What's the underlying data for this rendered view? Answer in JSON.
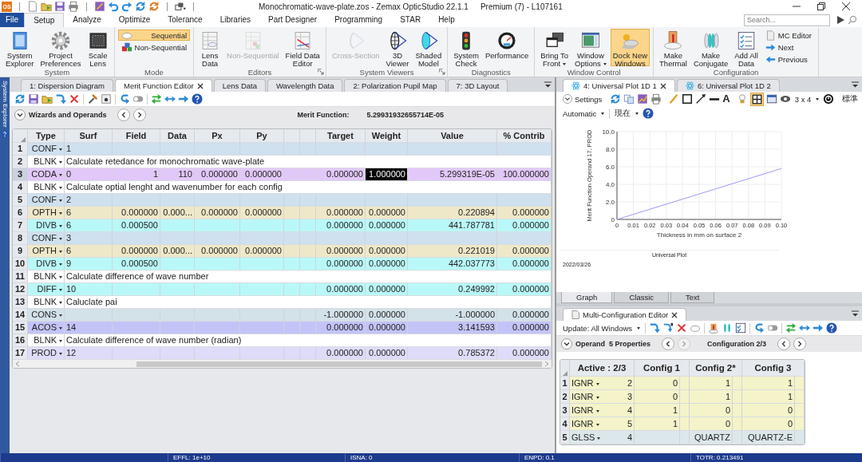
{
  "title_bar": {
    "app_logo": "OS",
    "title": "Monochromatic-wave-plate.zos - Zemax OpticStudio 22.1.1",
    "license": "Premium (7) - L107161"
  },
  "menu_tabs": [
    {
      "label": "File",
      "kind": "file",
      "selected": false
    },
    {
      "label": "Setup",
      "kind": "tab",
      "selected": true
    },
    {
      "label": "Analyze",
      "kind": "tab",
      "selected": false
    },
    {
      "label": "Optimize",
      "kind": "tab",
      "selected": false
    },
    {
      "label": "Tolerance",
      "kind": "tab",
      "selected": false
    },
    {
      "label": "Libraries",
      "kind": "tab",
      "selected": false
    },
    {
      "label": "Part Designer",
      "kind": "tab",
      "selected": false
    },
    {
      "label": "Programming",
      "kind": "tab",
      "selected": false
    },
    {
      "label": "STAR",
      "kind": "tab",
      "selected": false
    },
    {
      "label": "Help",
      "kind": "tab",
      "selected": false
    }
  ],
  "search": {
    "placeholder": "Search..."
  },
  "ribbon": [
    {
      "group": "System",
      "launcher": false,
      "buttons": [
        {
          "label": "System\nExplorer",
          "kind": "large",
          "disabled": false,
          "active": false,
          "dropdown": false
        },
        {
          "label": "Project\nPreferences",
          "kind": "large",
          "disabled": false,
          "active": false,
          "dropdown": false
        },
        {
          "label": "Scale\nLens",
          "kind": "large",
          "disabled": false,
          "active": false,
          "dropdown": false
        }
      ]
    },
    {
      "group": "Mode",
      "launcher": false,
      "buttons": [
        {
          "label": "Sequential",
          "kind": "small",
          "disabled": false,
          "active": true,
          "dropdown": false
        },
        {
          "label": "Non-Sequential",
          "kind": "small",
          "disabled": false,
          "active": false,
          "dropdown": false
        }
      ]
    },
    {
      "group": "Editors",
      "launcher": true,
      "buttons": [
        {
          "label": "Lens\nData",
          "kind": "large",
          "disabled": false,
          "active": false,
          "dropdown": false
        },
        {
          "label": "Non-Sequential",
          "kind": "large",
          "disabled": true,
          "active": false,
          "dropdown": false
        },
        {
          "label": "Field Data\nEditor",
          "kind": "large",
          "disabled": false,
          "active": false,
          "dropdown": false
        }
      ]
    },
    {
      "group": "System Viewers",
      "launcher": true,
      "buttons": [
        {
          "label": "Cross-Section",
          "kind": "large",
          "disabled": true,
          "active": false,
          "dropdown": false
        },
        {
          "label": "3D\nViewer",
          "kind": "large",
          "disabled": false,
          "active": false,
          "dropdown": false
        },
        {
          "label": "Shaded\nModel",
          "kind": "large",
          "disabled": false,
          "active": false,
          "dropdown": false
        }
      ]
    },
    {
      "group": "Diagnostics",
      "launcher": false,
      "buttons": [
        {
          "label": "System\nCheck",
          "kind": "large",
          "disabled": false,
          "active": false,
          "dropdown": false
        },
        {
          "label": "Performance",
          "kind": "large",
          "disabled": false,
          "active": false,
          "dropdown": false
        }
      ]
    },
    {
      "group": "Window Control",
      "launcher": false,
      "buttons": [
        {
          "label": "Bring To\nFront",
          "kind": "large",
          "disabled": false,
          "active": false,
          "dropdown": true
        },
        {
          "label": "Window\nOptions",
          "kind": "large",
          "disabled": false,
          "active": false,
          "dropdown": true
        },
        {
          "label": "Dock New\nWindows",
          "kind": "large",
          "disabled": false,
          "active": true,
          "dropdown": false
        }
      ]
    },
    {
      "group": "Configuration",
      "launcher": false,
      "buttons": [
        {
          "label": "Make\nThermal",
          "kind": "large",
          "disabled": false,
          "active": false,
          "dropdown": false
        },
        {
          "label": "Make\nConjugate",
          "kind": "large",
          "disabled": false,
          "active": false,
          "dropdown": false
        },
        {
          "label": "Add All\nData",
          "kind": "large",
          "disabled": false,
          "active": false,
          "dropdown": false
        },
        {
          "label": "MC Editor",
          "kind": "small",
          "disabled": false,
          "active": false,
          "dropdown": false
        },
        {
          "label": "Next",
          "kind": "small",
          "disabled": false,
          "active": false,
          "dropdown": false
        },
        {
          "label": "Previous",
          "kind": "small",
          "disabled": false,
          "active": false,
          "dropdown": false
        }
      ]
    }
  ],
  "side_strip": {
    "label": "System Explorer"
  },
  "left_pane": {
    "tabs": [
      {
        "label": "1: Dispersion Diagram",
        "selected": false,
        "closable": false
      },
      {
        "label": "Merit Function Editor",
        "selected": true,
        "closable": true
      },
      {
        "label": "Lens Data",
        "selected": false,
        "closable": false
      },
      {
        "label": "Wavelength Data",
        "selected": false,
        "closable": false
      },
      {
        "label": "2: Polarization Pupil Map",
        "selected": false,
        "closable": false
      },
      {
        "label": "7: 3D Layout",
        "selected": false,
        "closable": false
      }
    ],
    "wizard": {
      "label": "Wizards and Operands",
      "metric_label": "Merit Function:",
      "metric_value": "5.29931932655714E-05"
    },
    "table": {
      "columns": [
        "Type",
        "Surf",
        "Field",
        "Data",
        "Px",
        "Py",
        "Target",
        "Weight",
        "Value",
        "% Contrib"
      ],
      "rows": [
        {
          "num": "1",
          "kind": "operand",
          "type": "CONF",
          "surf": "1",
          "color": "#cfe0ef",
          "selected": false
        },
        {
          "num": "2",
          "kind": "comment",
          "type": "BLNK",
          "comment": "Calculate retedance for monochromatic wave-plate",
          "color": "#ffffff",
          "selected": false
        },
        {
          "num": "3",
          "kind": "operand",
          "type": "CODA",
          "surf": "0",
          "field": "1",
          "data": "110",
          "px": "0.000000",
          "py": "0.000000",
          "target": "0.000000",
          "weight": "1.000000",
          "value": "5.299319E-05",
          "contrib": "100.000000",
          "color": "#e2c8f8",
          "selected": true
        },
        {
          "num": "4",
          "kind": "comment",
          "type": "BLNK",
          "comment": "Calculate optial lenght and wavenumber for each config",
          "color": "#ffffff",
          "selected": false
        },
        {
          "num": "5",
          "kind": "operand",
          "type": "CONF",
          "surf": "2",
          "color": "#cfe0ef",
          "selected": false
        },
        {
          "num": "6",
          "kind": "operand",
          "type": "OPTH",
          "surf": "6",
          "field": "0.000000",
          "data": "0.000...",
          "px": "0.000000",
          "py": "0.000000",
          "target": "0.000000",
          "weight": "0.000000",
          "value": "0.220894",
          "contrib": "0.000000",
          "color": "#efe8c8",
          "selected": false
        },
        {
          "num": "7",
          "kind": "operand",
          "type": "DIVB",
          "surf": "6",
          "field": "0.000500",
          "target": "0.000000",
          "weight": "0.000000",
          "value": "441.787781",
          "contrib": "0.000000",
          "color": "#b9f8f8",
          "selected": false
        },
        {
          "num": "8",
          "kind": "operand",
          "type": "CONF",
          "surf": "3",
          "color": "#cfe0ef",
          "selected": false
        },
        {
          "num": "9",
          "kind": "operand",
          "type": "OPTH",
          "surf": "6",
          "field": "0.000000",
          "data": "0.000...",
          "px": "0.000000",
          "py": "0.000000",
          "target": "0.000000",
          "weight": "0.000000",
          "value": "0.221019",
          "contrib": "0.000000",
          "color": "#efe8c8",
          "selected": false
        },
        {
          "num": "10",
          "kind": "operand",
          "type": "DIVB",
          "surf": "9",
          "field": "0.000500",
          "target": "0.000000",
          "weight": "0.000000",
          "value": "442.037773",
          "contrib": "0.000000",
          "color": "#b9f8f8",
          "selected": false
        },
        {
          "num": "11",
          "kind": "comment",
          "type": "BLNK",
          "comment": "Calculate difference of wave number",
          "color": "#ffffff",
          "selected": false
        },
        {
          "num": "12",
          "kind": "operand",
          "type": "DIFF",
          "surf": "10",
          "target": "0.000000",
          "weight": "0.000000",
          "value": "0.249992",
          "contrib": "0.000000",
          "color": "#b9f8f8",
          "selected": false
        },
        {
          "num": "13",
          "kind": "comment",
          "type": "BLNK",
          "comment": "Caluclate pai",
          "color": "#ffffff",
          "selected": false
        },
        {
          "num": "14",
          "kind": "operand",
          "type": "CONS",
          "target": "-1.000000",
          "weight": "0.000000",
          "value": "-1.000000",
          "contrib": "0.000000",
          "color": "#d3e1e9",
          "selected": false
        },
        {
          "num": "15",
          "kind": "operand",
          "type": "ACOS",
          "surf": "14",
          "target": "0.000000",
          "weight": "0.000000",
          "value": "3.141593",
          "contrib": "0.000000",
          "color": "#c3c3f8",
          "selected": false
        },
        {
          "num": "16",
          "kind": "comment",
          "type": "BLNK",
          "comment": "Calculate difference of wave number (radian)",
          "color": "#ffffff",
          "selected": false
        },
        {
          "num": "17",
          "kind": "operand",
          "type": "PROD",
          "surf": "12",
          "target": "0.000000",
          "weight": "0.000000",
          "value": "0.785372",
          "contrib": "0.000000",
          "color": "#dedcf8",
          "selected": false
        }
      ]
    }
  },
  "plot_pane": {
    "tabs": [
      {
        "label": "4: Universal Plot 1D 1",
        "selected": true,
        "closable": true
      },
      {
        "label": "6: Universal Plot 1D 2",
        "selected": false,
        "closable": false
      }
    ],
    "toolbar": {
      "settings": "Settings",
      "text_tool": "A",
      "layout": "3 x 4",
      "style": "標準",
      "mode": "Automatic",
      "time": "現在"
    },
    "chart_data": {
      "type": "line",
      "grid": true,
      "xlabel": "Thickness in mm on surface 2",
      "ylabel": "Merit Function Operand 17, PROD",
      "x": [
        0,
        0.1
      ],
      "series": [
        {
          "color": "#9a9af4",
          "values": [
            0,
            5.8
          ]
        }
      ],
      "xlim": [
        0,
        0.1
      ],
      "ylim": [
        0,
        10
      ],
      "xticks": [
        {
          "value": 0,
          "label": "0"
        },
        {
          "value": 0.01,
          "label": "0.01"
        },
        {
          "value": 0.02,
          "label": "0.02"
        },
        {
          "value": 0.03,
          "label": "0.03"
        },
        {
          "value": 0.04,
          "label": "0.04"
        },
        {
          "value": 0.05,
          "label": "0.05"
        },
        {
          "value": 0.06,
          "label": "0.06"
        },
        {
          "value": 0.07,
          "label": "0.07"
        },
        {
          "value": 0.08,
          "label": "0.08"
        },
        {
          "value": 0.09,
          "label": "0.09"
        },
        {
          "value": 0.1,
          "label": "0.10"
        }
      ],
      "yticks": [
        {
          "value": 0,
          "label": "0"
        },
        {
          "value": 2,
          "label": "2.0"
        },
        {
          "value": 4,
          "label": "4.0"
        },
        {
          "value": 6,
          "label": "6.0"
        },
        {
          "value": 8,
          "label": "8.0"
        },
        {
          "value": 10,
          "label": "10.0"
        }
      ]
    },
    "footer": {
      "title": "Universal Plot",
      "date": "2022/03/26"
    },
    "bottom_tabs": [
      {
        "label": "Graph",
        "selected": true
      },
      {
        "label": "Classic",
        "selected": false
      },
      {
        "label": "Text",
        "selected": false
      }
    ]
  },
  "mce": {
    "tabs": [
      {
        "label": "Multi-Configuration Editor",
        "selected": true,
        "closable": true
      }
    ],
    "update": "Update: All Windows",
    "operand_label": "Operand  5 Properties",
    "operand_nav": {
      "prev_disabled": false,
      "next_disabled": true
    },
    "config_label": "Configuration 2/3",
    "columns": [
      "Active : 2/3",
      "Config 1",
      "Config 2*",
      "Config 3"
    ],
    "rows": [
      {
        "num": "1",
        "type": "IGNR",
        "param": "2",
        "c1": "0",
        "c2": "1",
        "c3": "1",
        "color": "#f4f3c9"
      },
      {
        "num": "2",
        "type": "IGNR",
        "param": "3",
        "c1": "0",
        "c2": "1",
        "c3": "1",
        "color": "#f4f3c9"
      },
      {
        "num": "3",
        "type": "IGNR",
        "param": "4",
        "c1": "1",
        "c2": "0",
        "c3": "0",
        "color": "#f4f3c9"
      },
      {
        "num": "4",
        "type": "IGNR",
        "param": "5",
        "c1": "1",
        "c2": "0",
        "c3": "0",
        "color": "#f4f3c9"
      },
      {
        "num": "5",
        "type": "GLSS",
        "param": "4",
        "c2": "QUARTZ",
        "c3": "QUARTZ-E",
        "color": "#dce7eb"
      }
    ]
  },
  "status_bar": [
    "EFFL: 1e+10",
    "ISNA: 0",
    "ENPD: 0.1",
    "TOTR: 0.213491"
  ]
}
